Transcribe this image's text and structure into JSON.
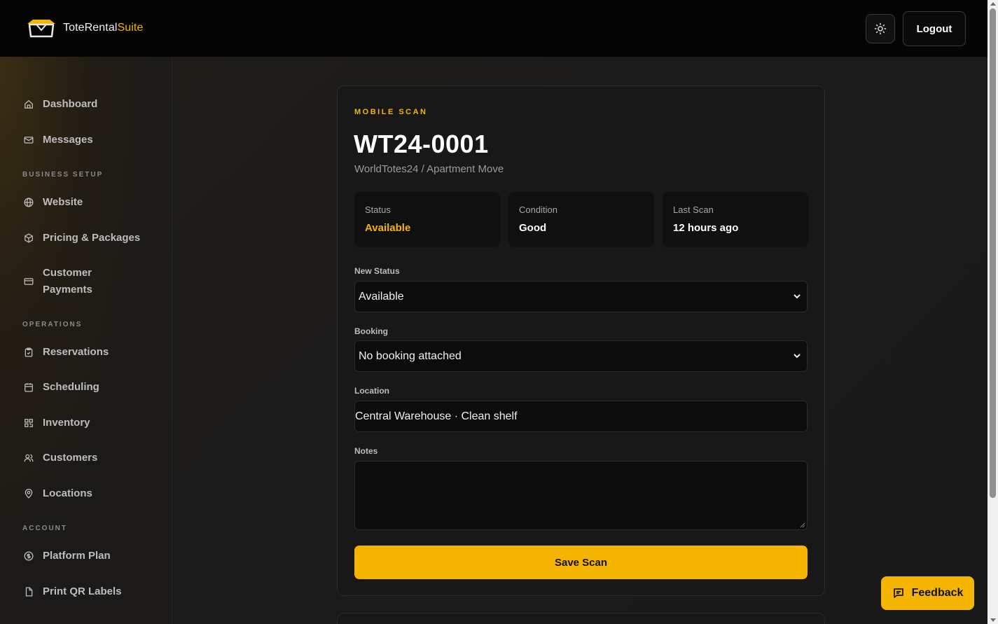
{
  "app": {
    "name_part1": "ToteRental",
    "name_part2": "Suite",
    "logout_label": "Logout",
    "accent_color": "#f5b400"
  },
  "sidebar": {
    "items": [
      {
        "label": "Dashboard",
        "icon": "home-icon"
      },
      {
        "label": "Messages",
        "icon": "mail-icon"
      },
      {
        "label": "Website",
        "icon": "globe-icon"
      },
      {
        "label": "Pricing & Packages",
        "icon": "package-icon"
      },
      {
        "label": "Customer Payments",
        "icon": "credit-card-icon"
      },
      {
        "label": "Reservations",
        "icon": "clipboard-icon"
      },
      {
        "label": "Scheduling",
        "icon": "calendar-icon"
      },
      {
        "label": "Inventory",
        "icon": "qr-code-icon"
      },
      {
        "label": "Customers",
        "icon": "users-icon"
      },
      {
        "label": "Locations",
        "icon": "map-pin-icon"
      },
      {
        "label": "Platform Plan",
        "icon": "dollar-circle-icon"
      },
      {
        "label": "Print QR Labels",
        "icon": "file-icon"
      }
    ],
    "sections": {
      "business_setup": "BUSINESS SETUP",
      "operations": "OPERATIONS",
      "account": "ACCOUNT"
    }
  },
  "scan": {
    "eyebrow": "MOBILE SCAN",
    "tote_id": "WT24-0001",
    "subtitle": "WorldTotes24 / Apartment Move",
    "stats": [
      {
        "label": "Status",
        "value": "Available"
      },
      {
        "label": "Condition",
        "value": "Good"
      },
      {
        "label": "Last Scan",
        "value": "12 hours ago"
      }
    ],
    "new_status_label": "New Status",
    "new_status_value": "Available",
    "booking_label": "Booking",
    "booking_value": "No booking attached",
    "location_label": "Location",
    "location_value": "Central Warehouse · Clean shelf",
    "notes_label": "Notes",
    "notes_value": "",
    "save_label": "Save Scan"
  },
  "feedback_label": "Feedback"
}
